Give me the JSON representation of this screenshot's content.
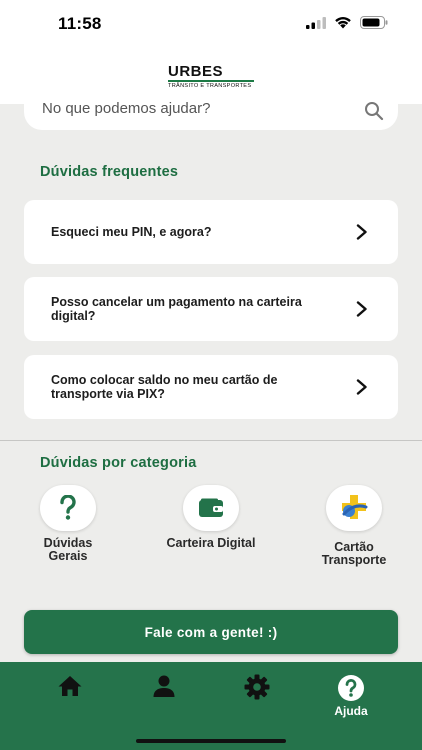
{
  "status_bar": {
    "time": "11:58"
  },
  "header": {
    "logo_main": "URBES",
    "logo_sub": "TRÂNSITO E TRANSPORTES"
  },
  "search": {
    "placeholder": "No que podemos ajudar?"
  },
  "faq": {
    "title": "Dúvidas frequentes",
    "items": [
      {
        "text": "Esqueci meu PIN, e agora?"
      },
      {
        "text": "Posso cancelar um pagamento na carteira digital?"
      },
      {
        "text": "Como colocar saldo no meu cartão de transporte via PIX?"
      }
    ]
  },
  "categories": {
    "title": "Dúvidas por categoria",
    "items": [
      {
        "label": "Dúvidas Gerais",
        "icon": "question-icon"
      },
      {
        "label": "Carteira Digital",
        "icon": "wallet-icon"
      },
      {
        "label": "Cartão Transporte",
        "icon": "transport-card-icon"
      }
    ]
  },
  "cta": {
    "label": "Fale com a gente! :)"
  },
  "bottom_nav": {
    "items": [
      {
        "icon": "home-icon",
        "label": ""
      },
      {
        "icon": "person-icon",
        "label": ""
      },
      {
        "icon": "gear-icon",
        "label": ""
      },
      {
        "icon": "help-icon",
        "label": "Ajuda"
      }
    ]
  },
  "colors": {
    "brand_green": "#25734b",
    "title_green": "#1e6e42",
    "background": "#ededeb"
  }
}
